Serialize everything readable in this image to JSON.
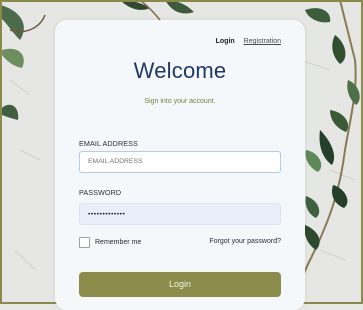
{
  "nav": {
    "login_label": "Login",
    "registration_label": "Registration"
  },
  "header": {
    "title": "Welcome",
    "subtitle": "Sign into your account."
  },
  "form": {
    "email_label": "EMAIL ADDRESS",
    "email_placeholder": "EMAIL ADDRESS",
    "email_value": "",
    "password_label": "PASSWORD",
    "password_value": "•••••••••••••",
    "remember_label": "Remember me",
    "remember_checked": false,
    "forgot_label": "Forgot your password?",
    "submit_label": "Login"
  },
  "colors": {
    "accent": "#8b8b4a",
    "title": "#213a64",
    "subtitle": "#7a7f37",
    "card": "#f4f8fb"
  }
}
